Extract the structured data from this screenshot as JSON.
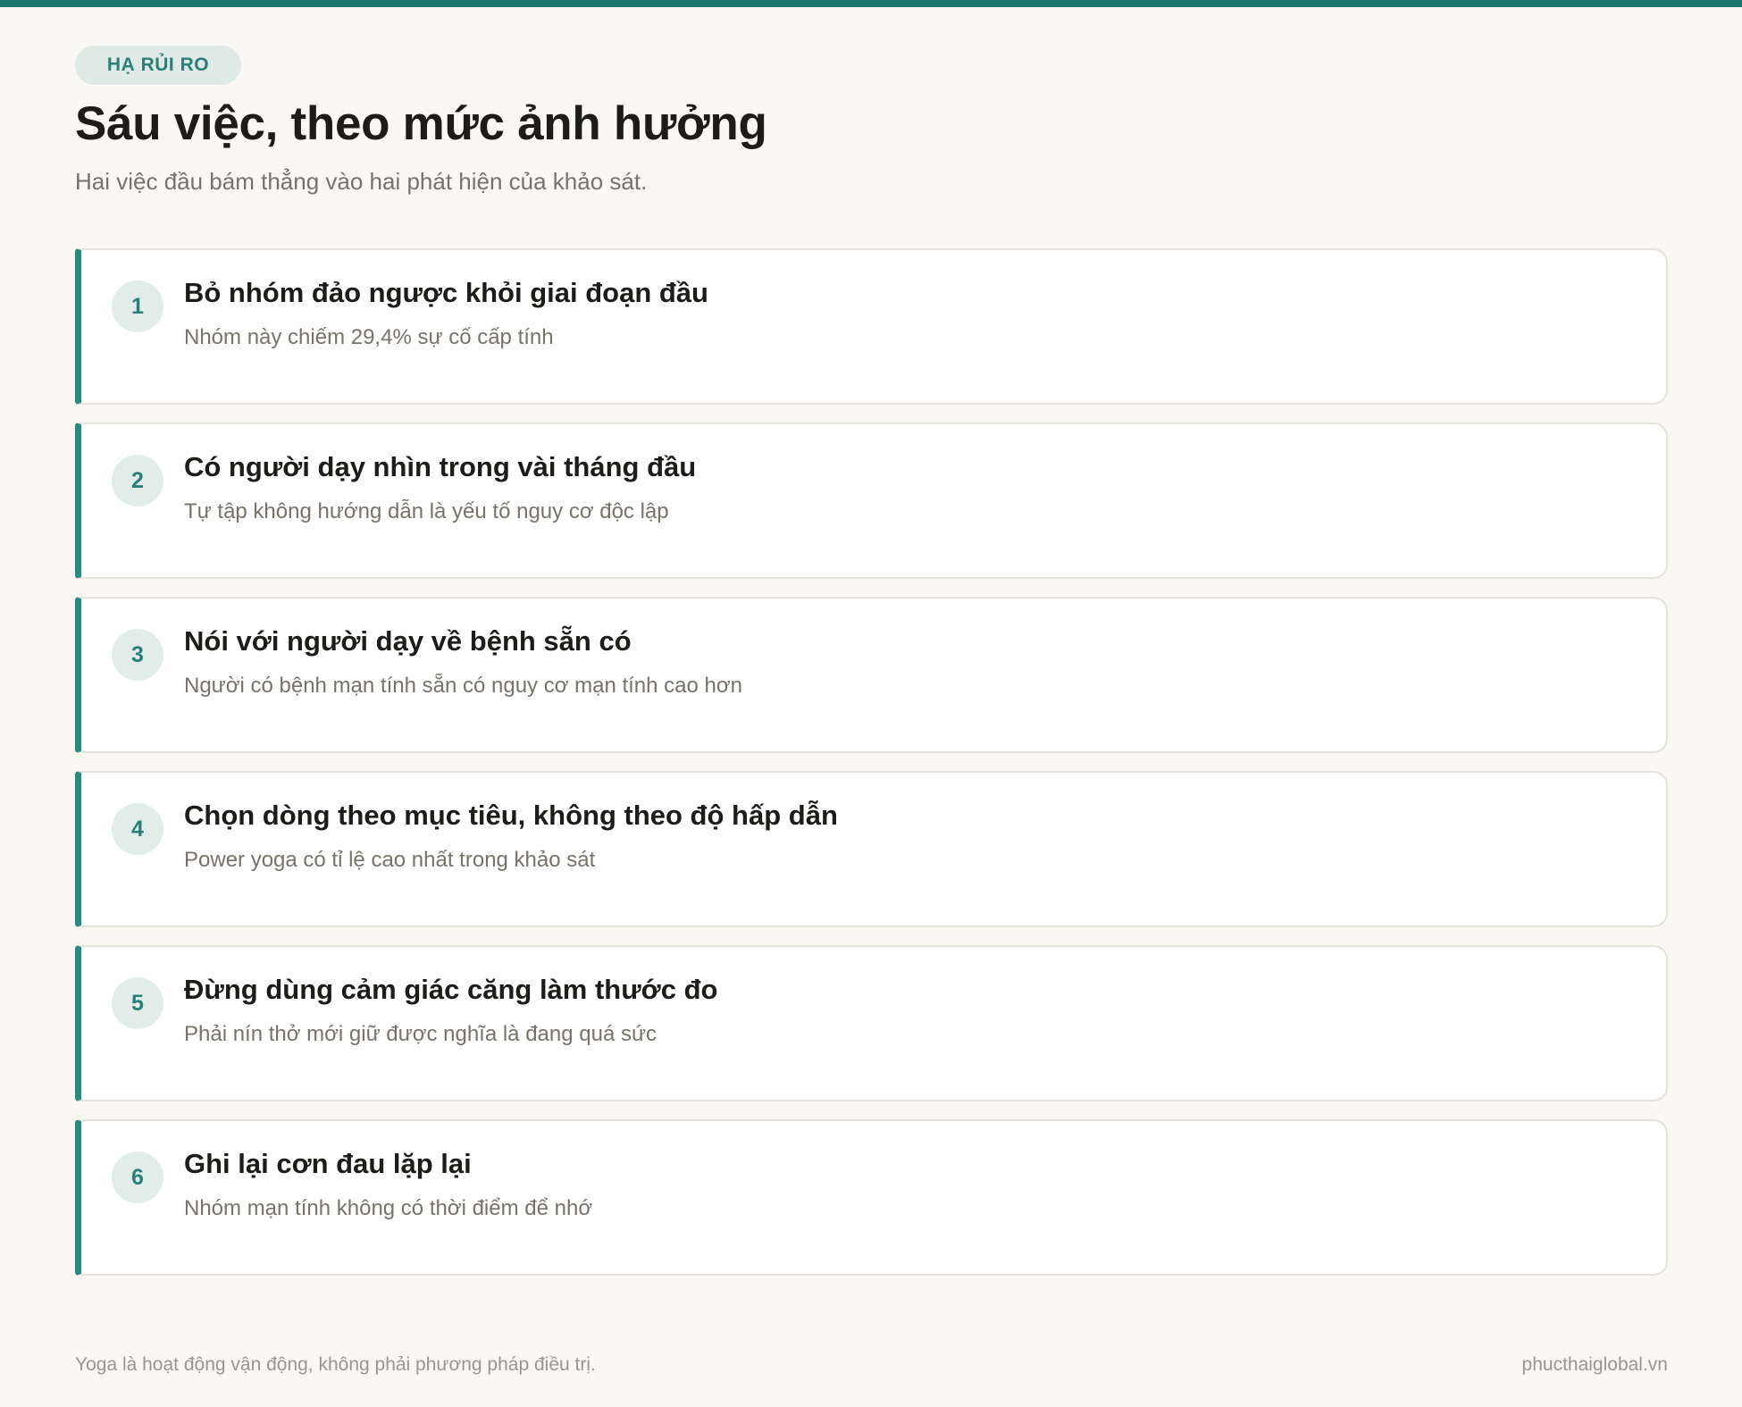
{
  "header": {
    "tag": "HẠ RỦI RO",
    "title": "Sáu việc, theo mức ảnh hưởng",
    "subtitle": "Hai việc đầu bám thẳng vào hai phát hiện của khảo sát."
  },
  "items": [
    {
      "number": "1",
      "title": "Bỏ nhóm đảo ngược khỏi giai đoạn đầu",
      "desc": "Nhóm này chiếm 29,4% sự cố cấp tính"
    },
    {
      "number": "2",
      "title": "Có người dạy nhìn trong vài tháng đầu",
      "desc": "Tự tập không hướng dẫn là yếu tố nguy cơ độc lập"
    },
    {
      "number": "3",
      "title": "Nói với người dạy về bệnh sẵn có",
      "desc": "Người có bệnh mạn tính sẵn có nguy cơ mạn tính cao hơn"
    },
    {
      "number": "4",
      "title": "Chọn dòng theo mục tiêu, không theo độ hấp dẫn",
      "desc": "Power yoga có tỉ lệ cao nhất trong khảo sát"
    },
    {
      "number": "5",
      "title": "Đừng dùng cảm giác căng làm thước đo",
      "desc": "Phải nín thở mới giữ được nghĩa là đang quá sức"
    },
    {
      "number": "6",
      "title": "Ghi lại cơn đau lặp lại",
      "desc": "Nhóm mạn tính không có thời điểm để nhớ"
    }
  ],
  "footer": {
    "note": "Yoga là hoạt động vận động, không phải phương pháp điều trị.",
    "site": "phucthaiglobal.vn"
  },
  "colors": {
    "accent": "#18766f",
    "background": "#f9f8f5"
  }
}
